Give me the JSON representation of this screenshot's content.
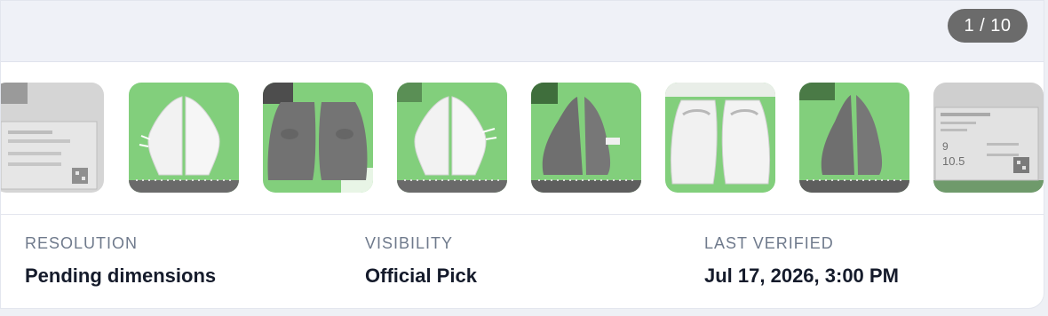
{
  "gallery": {
    "counter": "1 / 10",
    "thumbnails": [
      {
        "name": "thumb-box-label-partial",
        "alt": "Box label (faded)"
      },
      {
        "name": "thumb-white-sneakers-side",
        "alt": "White sneakers side view"
      },
      {
        "name": "thumb-gray-sneakers-back",
        "alt": "Sneakers heel view"
      },
      {
        "name": "thumb-white-sneakers-side-2",
        "alt": "White sneakers side view"
      },
      {
        "name": "thumb-gray-sneakers-profile",
        "alt": "Sneakers profile"
      },
      {
        "name": "thumb-white-sneakers-rear",
        "alt": "White sneakers rear view"
      },
      {
        "name": "thumb-gray-sneakers-profile-2",
        "alt": "Sneakers profile"
      },
      {
        "name": "thumb-box-label-size",
        "alt": "Box size label"
      }
    ]
  },
  "details": {
    "resolution": {
      "label": "RESOLUTION",
      "value": "Pending dimensions"
    },
    "visibility": {
      "label": "VISIBILITY",
      "value": "Official Pick"
    },
    "last_verified": {
      "label": "LAST VERIFIED",
      "value": "Jul 17, 2026, 3:00 PM"
    }
  },
  "box_label": {
    "size_us": "9",
    "size_uk": "10.5"
  },
  "colors": {
    "accent_green": "#82cf7c",
    "counter_bg": "#6b6b6b",
    "label_text": "#6f7a8c",
    "value_text": "#151b2b"
  }
}
